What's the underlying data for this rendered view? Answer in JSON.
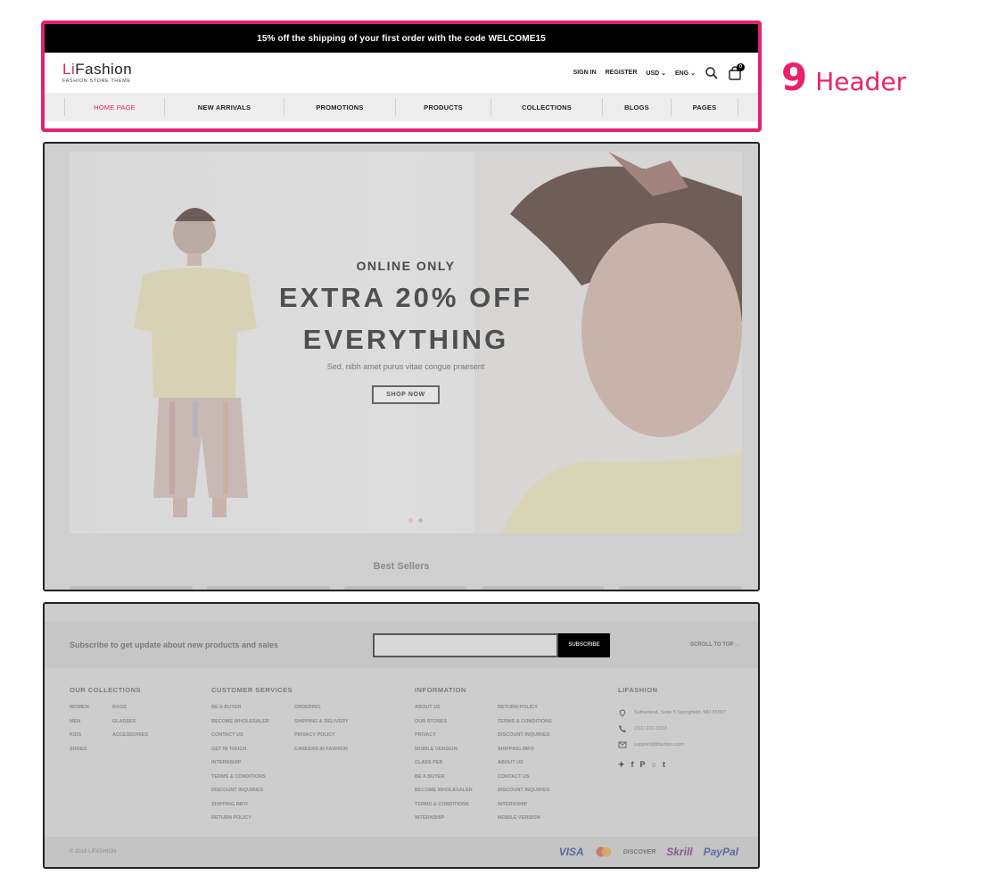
{
  "annotation": {
    "number": "9",
    "label": "Header"
  },
  "header": {
    "promo_text": "15% off the shipping of your first order with the code WELCOME15",
    "logo": {
      "accent": "Li",
      "word": "Fashion",
      "tagline": "FASHION STORE THEME"
    },
    "utility": {
      "sign_in": "SIGN IN",
      "register": "REGISTER",
      "currency": "USD",
      "language": "ENG",
      "search_icon": "search-icon",
      "cart_icon": "shopping-bag-icon",
      "cart_count": "0"
    },
    "nav": [
      {
        "label": "HOME PAGE",
        "active": true
      },
      {
        "label": "NEW ARRIVALS",
        "active": false
      },
      {
        "label": "PROMOTIONS",
        "active": false
      },
      {
        "label": "PRODUCTS",
        "active": false
      },
      {
        "label": "COLLECTIONS",
        "active": false
      },
      {
        "label": "BLOGS",
        "active": false
      },
      {
        "label": "PAGES",
        "active": false
      }
    ]
  },
  "hero": {
    "kicker": "ONLINE ONLY",
    "title_line1": "EXTRA 20% OFF",
    "title_line2": "EVERYTHING",
    "subtitle": "Sed, nibh amet purus vitae congue praesent",
    "button": "SHOP NOW",
    "section_title": "Best Sellers"
  },
  "footer": {
    "subscribe_text": "Subscribe to get update about new products and sales",
    "subscribe_button": "SUBSCRIBE",
    "scroll_top": "SCROLL TO TOP",
    "columns": [
      {
        "title": "OUR COLLECTIONS",
        "lists": [
          [
            "WOMEN",
            "MEN",
            "KIDS",
            "SHOES"
          ],
          [
            "BAGS",
            "GLASSES",
            "ACCESSORIES"
          ]
        ]
      },
      {
        "title": "CUSTOMER SERVICES",
        "lists": [
          [
            "BE A BUYER",
            "BECOME WHOLESALER",
            "CONTACT US",
            "GET IN TOUCH",
            "INTERNSHIP",
            "TERMS & CONDITIONS",
            "DISCOUNT INQUIRIES",
            "SHIPPING INFO",
            "RETURN POLICY"
          ],
          [
            "ORDERING",
            "SHIPPING & DELIVERY",
            "PRIVACY POLICY",
            "CAREERS IN FASHION"
          ]
        ]
      },
      {
        "title": "INFORMATION",
        "lists": [
          [
            "ABOUT US",
            "OUR STORES",
            "PRIVACY",
            "MOBILE VERSION",
            "CLASS PER",
            "BE A BUYER",
            "BECOME WHOLESALER",
            "TERMS & CONDITIONS",
            "INTERNSHIP"
          ],
          [
            "RETURN POLICY",
            "TERMS & CONDITIONS",
            "DISCOUNT INQUIRIES",
            "SHIPPING INFO",
            "ABOUT US",
            "CONTACT US",
            "DISCOUNT INQUIRIES",
            "INTERNSHIP",
            "MOBILE VERSION"
          ]
        ]
      }
    ],
    "brand_column": {
      "title": "LIFASHION",
      "address": "Sutherland, Suite 5 Springfield, MO 65807",
      "phone": "(111) 222-3333",
      "email": "support@lifashion.com",
      "socials": [
        "twitter-icon",
        "facebook-icon",
        "pinterest-icon",
        "instagram-icon",
        "tumblr-icon"
      ]
    },
    "copyright": "© 2019 LIFASHION",
    "payments": [
      "VISA",
      "MC",
      "DISCOVER",
      "Skrill",
      "PayPal"
    ]
  },
  "colors": {
    "accent": "#e5216f",
    "promo_bg": "#000000",
    "nav_bg": "#ededed"
  }
}
